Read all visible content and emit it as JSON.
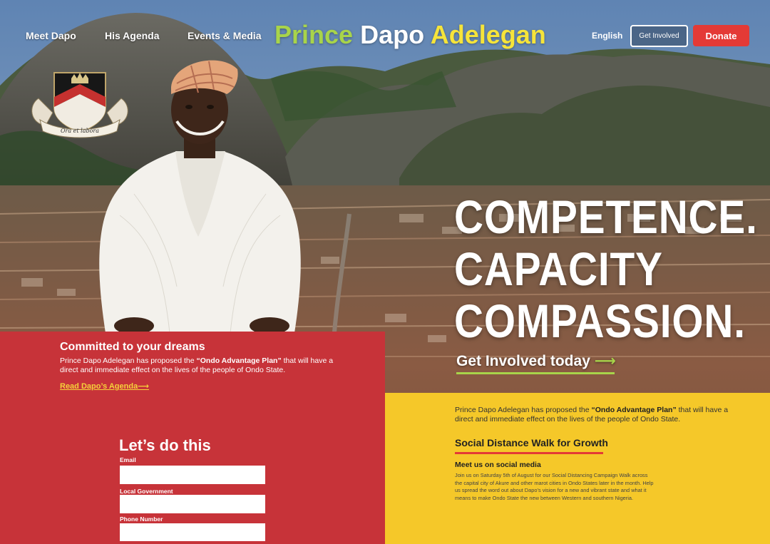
{
  "nav": {
    "items": [
      "Meet Dapo",
      "His Agenda",
      "Events & Media"
    ],
    "brand": {
      "part1": "Prince",
      "part2": "Dapo",
      "part3": "Adelegan"
    },
    "language": "English",
    "get_involved": "Get Involved",
    "donate": "Donate"
  },
  "crest": {
    "motto": "Ora et labora"
  },
  "hero": {
    "headline_line1": "COMPETENCE.",
    "headline_line2": "CAPACITY",
    "headline_line3": "COMPASSION.",
    "cta_text": "Get Involved today",
    "cta_arrow": "⟶"
  },
  "red_panel": {
    "title": "Committed to your dreams",
    "text_before": "Prince Dapo Adelegan has proposed the ",
    "text_bold": "“Ondo Advantage Plan”",
    "text_after": " that will have a direct and immediate effect on the lives of the people of Ondo State.",
    "agenda_link": "Read Dapo’s Agenda⟶"
  },
  "form": {
    "title": "Let’s do this",
    "email_label": "Email",
    "local_government_label": "Local Government",
    "phone_label": "Phone Number"
  },
  "yellow_panel": {
    "text_before": "Prince Dapo Adelegan has proposed the ",
    "text_bold": "“Ondo Advantage Plan”",
    "text_after": " that will have a direct and immediate effect on the lives of the people of Ondo State.",
    "heading": "Social Distance Walk for Growth",
    "subheading": "Meet us on social media",
    "body": "Join us on Saturday 5th of August for our Social Distancing Campaign Walk across the capital city of Akure and other marot cities in Ondo States later in the month. Help us spread the word out about Dapo’s vision for a new and vibrant state and what it means to make Ondo State the new between  Western and southern Nigeria."
  },
  "colors": {
    "red": "#c73339",
    "yellow": "#f5c829",
    "green_accent": "#a8d44a",
    "donate_red": "#e43a36"
  }
}
